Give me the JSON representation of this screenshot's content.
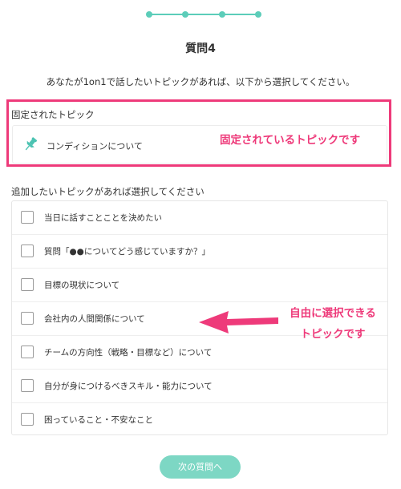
{
  "progress": {
    "total_steps": 4,
    "current_step": 4
  },
  "question": {
    "title": "質問4",
    "description": "あなたが1on1で話したいトピックがあれば、以下から選択してください。"
  },
  "pinned": {
    "heading": "固定されたトピック",
    "icon": "pin-icon",
    "topic": "コンディションについて",
    "annotation": "固定されているトピックです"
  },
  "optional": {
    "heading": "追加したいトピックがあれば選択してください",
    "items": [
      {
        "label": "当日に話すことことを決めたい",
        "checked": false
      },
      {
        "label": "質問「●●についてどう感じていますか？」",
        "checked": false
      },
      {
        "label": "目標の現状について",
        "checked": false
      },
      {
        "label": "会社内の人間関係について",
        "checked": false
      },
      {
        "label": "チームの方向性（戦略・目標など）について",
        "checked": false
      },
      {
        "label": "自分が身につけるべきスキル・能力について",
        "checked": false
      },
      {
        "label": "困っていること・不安なこと",
        "checked": false
      }
    ],
    "annotation_line1": "自由に選択できる",
    "annotation_line2": "トピックです"
  },
  "next_button": {
    "label": "次の質問へ"
  },
  "colors": {
    "accent": "#5ccdb9",
    "annotation": "#ee3a7a",
    "button": "#7dd7c4"
  }
}
